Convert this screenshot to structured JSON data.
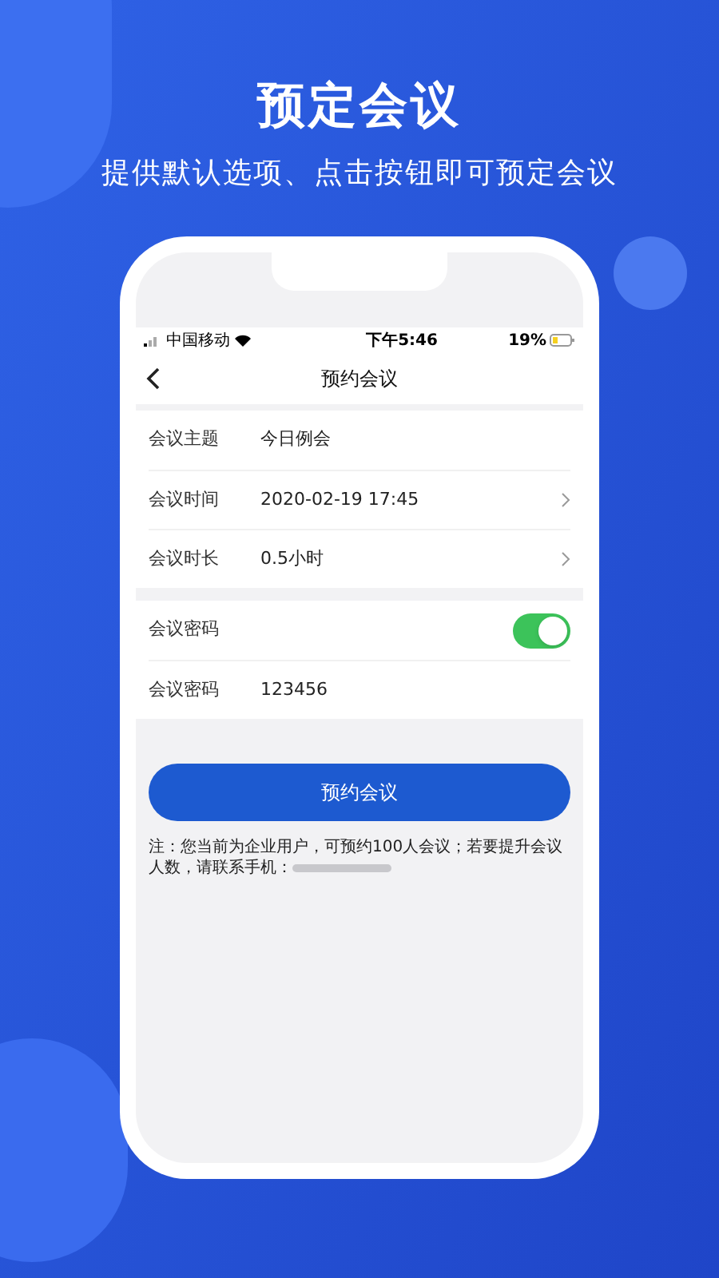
{
  "headline": "预定会议",
  "subheadline": "提供默认选项、点击按钮即可预定会议",
  "status_bar": {
    "carrier": "中国移动",
    "time": "下午5:46",
    "battery": "19%"
  },
  "nav": {
    "title": "预约会议"
  },
  "sections": [
    {
      "rows": [
        {
          "kind": "text",
          "label": "会议主题",
          "value": "今日例会"
        },
        {
          "kind": "link",
          "label": "会议时间",
          "value": "2020-02-19 17:45"
        },
        {
          "kind": "link",
          "label": "会议时长",
          "value": "0.5小时"
        }
      ]
    },
    {
      "rows": [
        {
          "kind": "toggle",
          "label": "会议密码",
          "on": true
        },
        {
          "kind": "text",
          "label": "会议密码",
          "value": "123456"
        }
      ]
    }
  ],
  "button": "预约会议",
  "note": "注：您当前为企业用户，可预约100人会议；若要提升会议人数，请联系手机："
}
